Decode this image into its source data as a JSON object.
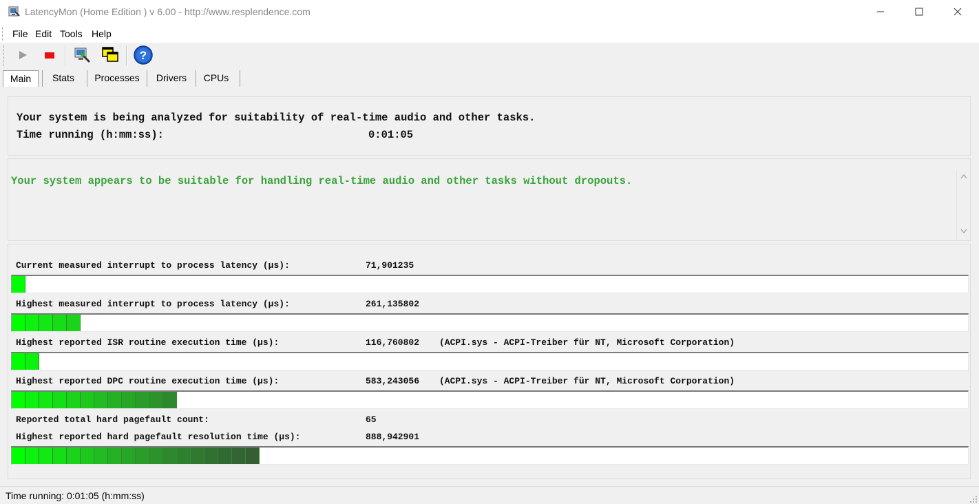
{
  "window": {
    "title": "LatencyMon  (Home Edition )  v 6.00 - http://www.resplendence.com"
  },
  "menu": {
    "items": [
      {
        "label": "File"
      },
      {
        "label": "Edit"
      },
      {
        "label": "Tools"
      },
      {
        "label": "Help"
      }
    ]
  },
  "toolbar": {
    "buttons": [
      "play-icon",
      "stop-icon",
      "computer-settings-icon",
      "windows-icon",
      "help-icon"
    ],
    "colors": {
      "stop": "#e81010",
      "help": "#1a5cc8"
    }
  },
  "tabs": [
    {
      "label": "Main",
      "active": true
    },
    {
      "label": "Stats",
      "active": false
    },
    {
      "label": "Processes",
      "active": false
    },
    {
      "label": "Drivers",
      "active": false
    },
    {
      "label": "CPUs",
      "active": false
    }
  ],
  "analysis": {
    "line1": "Your system is being analyzed for suitability of real-time audio and other tasks.",
    "line2_label": "Time running (h:mm:ss):",
    "line2_value": "0:01:05"
  },
  "verdict": {
    "text": "Your system appears to be suitable for handling real-time audio and other tasks without dropouts.",
    "color": "#3aa33a"
  },
  "metrics": [
    {
      "label": "Current measured interrupt to process latency (µs):",
      "value": "71,901235",
      "extra": "",
      "bar_segments": 1
    },
    {
      "label": "Highest measured interrupt to process latency (µs):",
      "value": "261,135802",
      "extra": "",
      "bar_segments": 5
    },
    {
      "label": "Highest reported ISR routine execution time (µs):",
      "value": "116,760802",
      "extra": "(ACPI.sys - ACPI-Treiber für NT, Microsoft Corporation)",
      "bar_segments": 2
    },
    {
      "label": "Highest reported DPC routine execution time (µs):",
      "value": "583,243056",
      "extra": "(ACPI.sys - ACPI-Treiber für NT, Microsoft Corporation)",
      "bar_segments": 12
    },
    {
      "label": "Reported total hard pagefault count:",
      "value": "65",
      "extra": "",
      "bar_segments": 0
    },
    {
      "label": "Highest reported hard pagefault resolution time (µs):",
      "value": "888,942901",
      "extra": "",
      "bar_segments": 18
    }
  ],
  "status": {
    "text": "Time running: 0:01:05  (h:mm:ss)"
  }
}
